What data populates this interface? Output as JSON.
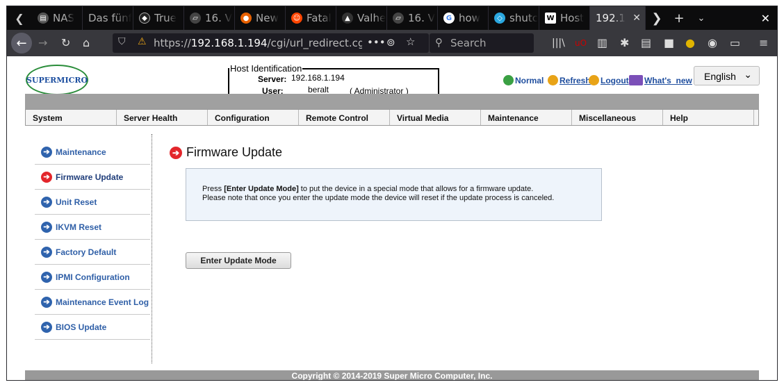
{
  "browser": {
    "tabs": [
      {
        "label": "NAS",
        "icon": "folder-icon",
        "color": "#555555"
      },
      {
        "label": "Das fünf",
        "icon": "blank-icon",
        "color": "#333333"
      },
      {
        "label": "True",
        "icon": "truenas-icon",
        "color": "#222222"
      },
      {
        "label": "16. V",
        "icon": "page-icon",
        "color": "#444444"
      },
      {
        "label": "New",
        "icon": "firefox-icon",
        "color": "#e66000"
      },
      {
        "label": "Fatal",
        "icon": "reddit-icon",
        "color": "#ff4500"
      },
      {
        "label": "Valhe",
        "icon": "linux-icon",
        "color": "#333333"
      },
      {
        "label": "16. V",
        "icon": "page-icon",
        "color": "#444444"
      },
      {
        "label": "how",
        "icon": "google-icon",
        "color": "#4285f4"
      },
      {
        "label": "shutc",
        "icon": "cube-icon",
        "color": "#2aa8e0"
      },
      {
        "label": "Host",
        "icon": "wikipedia-icon",
        "color": "#ffffff"
      }
    ],
    "active_tab": {
      "label": "192.1"
    },
    "url_prefix": "https://",
    "url_host": "192.168.1.194",
    "url_path": "/cgi/url_redirect.cgi?ur",
    "search_placeholder": "Search"
  },
  "header": {
    "logo_text": "SUPERMICRO",
    "host_legend": "Host Identification",
    "server_label": "Server:",
    "server_value": "192.168.1.194",
    "user_label": "User:",
    "user_value": "beralt",
    "user_role": "( Administrator )",
    "links": {
      "normal": "Normal",
      "refresh": "Refresh",
      "logout": "Logout",
      "whats_new": "What's  new"
    },
    "language": "English"
  },
  "menu": [
    "System",
    "Server Health",
    "Configuration",
    "Remote Control",
    "Virtual Media",
    "Maintenance",
    "Miscellaneous",
    "Help"
  ],
  "sidebar": [
    {
      "label": "Maintenance"
    },
    {
      "label": "Firmware Update"
    },
    {
      "label": "Unit Reset"
    },
    {
      "label": "IKVM Reset"
    },
    {
      "label": "Factory Default"
    },
    {
      "label": "IPMI Configuration"
    },
    {
      "label": "Maintenance Event Log"
    },
    {
      "label": "BIOS Update"
    }
  ],
  "main": {
    "title": "Firmware Update",
    "info_pre": "Press ",
    "info_bold": "[Enter Update Mode]",
    "info_post": " to put the device in a special mode that allows for a firmware update.",
    "info_line2": "Please note that once you enter the update mode the device will reset if the update process is canceled.",
    "button": "Enter Update Mode"
  },
  "footer": "Copyright © 2014-2019 Super Micro Computer, Inc."
}
